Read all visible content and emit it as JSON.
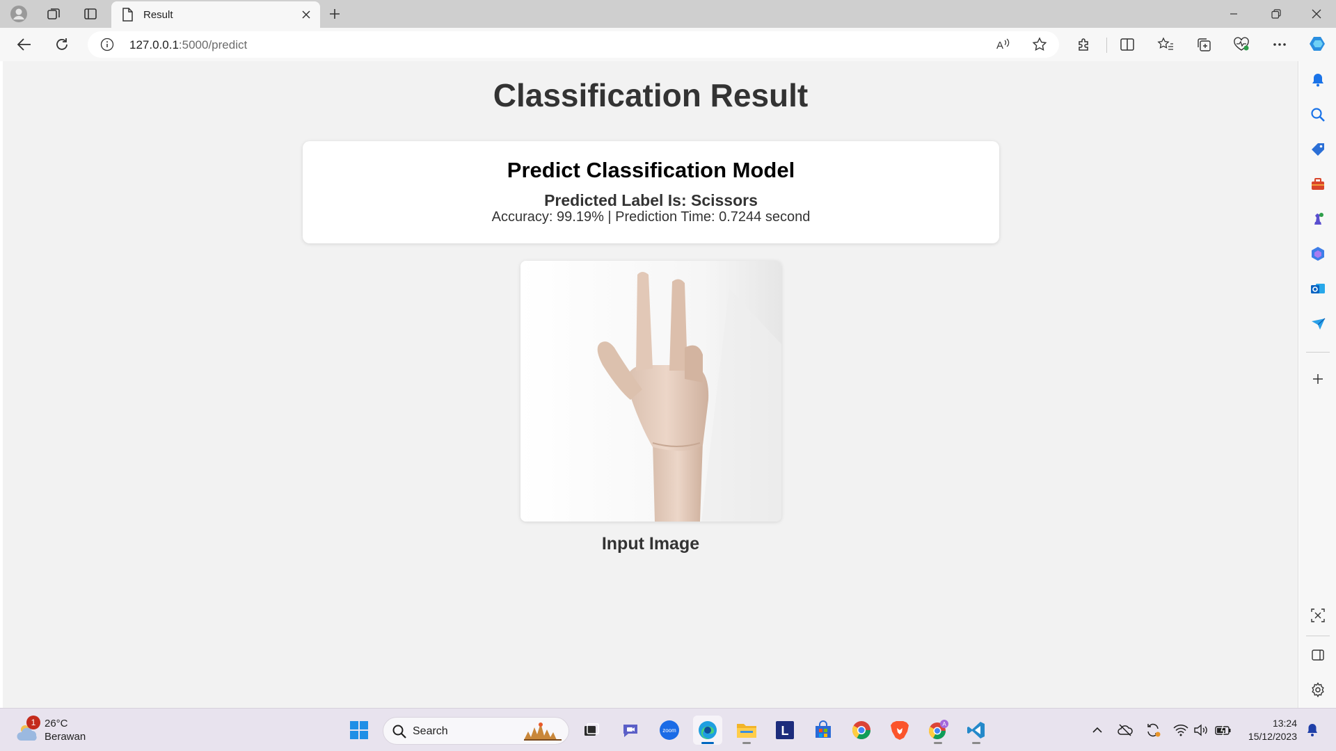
{
  "browser": {
    "tab_title": "Result",
    "url_host": "127.0.0.1",
    "url_path": ":5000/predict"
  },
  "page": {
    "title": "Classification Result",
    "card": {
      "heading": "Predict Classification Model",
      "predicted_label": "Predicted Label Is: Scissors",
      "stats": "Accuracy: 99.19% | Prediction Time: 0.7244 second"
    },
    "image_caption": "Input Image"
  },
  "taskbar": {
    "weather_temp": "26°C",
    "weather_condition": "Berawan",
    "weather_badge": "1",
    "search_placeholder": "Search",
    "time": "13:24",
    "date": "15/12/2023"
  },
  "colors": {
    "page_background": "#f2f2f2",
    "card_background": "#ffffff",
    "accent_blue": "#0067c0"
  }
}
